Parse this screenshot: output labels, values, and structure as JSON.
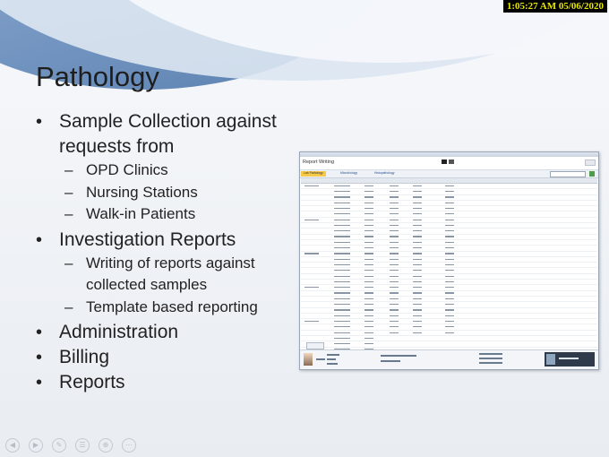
{
  "clock": {
    "text": "1:05:27 AM 05/06/2020"
  },
  "slide": {
    "title": "Pathology",
    "bullets": [
      {
        "text": "Sample Collection against requests from",
        "sub": [
          "OPD Clinics",
          "Nursing Stations",
          "Walk-in Patients"
        ]
      },
      {
        "text": "Investigation Reports",
        "sub": [
          "Writing of reports against collected samples",
          "Template based reporting"
        ]
      },
      {
        "text": "Administration"
      },
      {
        "text": "Billing"
      },
      {
        "text": "Reports"
      }
    ]
  },
  "embedded_app": {
    "title": "Report Writing",
    "tabs": [
      "Lab Pathology",
      "Microbiology",
      "Histopathology"
    ]
  },
  "nav_icons": [
    "back-icon",
    "forward-icon",
    "pen-icon",
    "menu-icon",
    "zoom-icon",
    "more-icon"
  ]
}
